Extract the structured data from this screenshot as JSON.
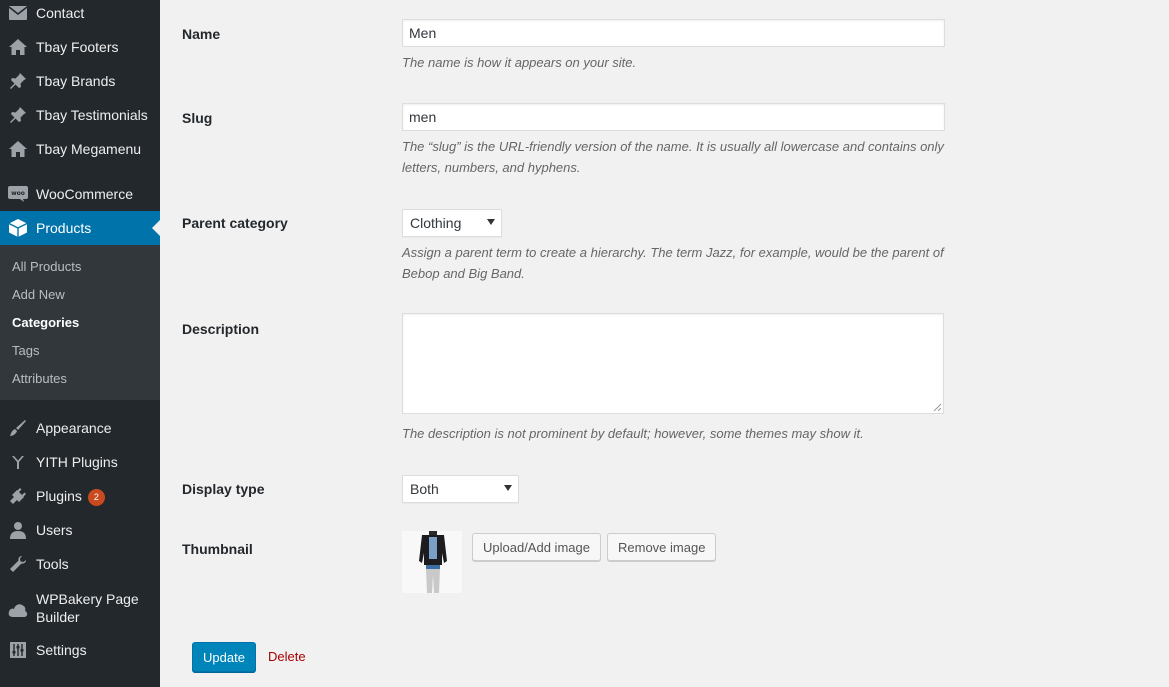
{
  "sidebar": {
    "items": [
      {
        "label": "Contact",
        "icon": "envelope-icon"
      },
      {
        "label": "Tbay Footers",
        "icon": "home-icon"
      },
      {
        "label": "Tbay Brands",
        "icon": "pin-icon"
      },
      {
        "label": "Tbay Testimonials",
        "icon": "pin-icon"
      },
      {
        "label": "Tbay Megamenu",
        "icon": "home-icon"
      },
      {
        "label": "WooCommerce",
        "icon": "woocommerce-icon"
      },
      {
        "label": "Products",
        "icon": "box-icon",
        "active": true
      },
      {
        "label": "Appearance",
        "icon": "brush-icon"
      },
      {
        "label": "YITH Plugins",
        "icon": "yith-icon"
      },
      {
        "label": "Plugins",
        "icon": "plug-icon",
        "badge": "2"
      },
      {
        "label": "Users",
        "icon": "user-icon"
      },
      {
        "label": "Tools",
        "icon": "wrench-icon"
      },
      {
        "label": "WPBakery Page Builder",
        "line1": "WPBakery Page",
        "line2": "Builder",
        "icon": "cloud-icon"
      },
      {
        "label": "Settings",
        "icon": "settings-sliders-icon"
      }
    ],
    "submenu": [
      {
        "label": "All Products"
      },
      {
        "label": "Add New"
      },
      {
        "label": "Categories",
        "current": true
      },
      {
        "label": "Tags"
      },
      {
        "label": "Attributes"
      }
    ]
  },
  "form": {
    "name": {
      "label": "Name",
      "value": "Men",
      "help": "The name is how it appears on your site."
    },
    "slug": {
      "label": "Slug",
      "value": "men",
      "help_line1": "The “slug” is the URL-friendly version of the name. It is usually all lowercase and contains only",
      "help_line2": "letters, numbers, and hyphens."
    },
    "parent": {
      "label": "Parent category",
      "value": "Clothing",
      "help_line1": "Assign a parent term to create a hierarchy. The term Jazz, for example, would be the parent of",
      "help_line2": "Bebop and Big Band."
    },
    "description": {
      "label": "Description",
      "value": "",
      "help": "The description is not prominent by default; however, some themes may show it."
    },
    "display_type": {
      "label": "Display type",
      "value": "Both"
    },
    "thumbnail": {
      "label": "Thumbnail",
      "upload_label": "Upload/Add image",
      "remove_label": "Remove image"
    },
    "update_label": "Update",
    "delete_label": "Delete"
  },
  "colors": {
    "sidebar_bg": "#23282d",
    "submenu_bg": "#32373c",
    "active_bg": "#0073aa",
    "primary_button": "#0085ba",
    "delete_link": "#aa0000",
    "plugin_badge": "#ca4a1f"
  }
}
